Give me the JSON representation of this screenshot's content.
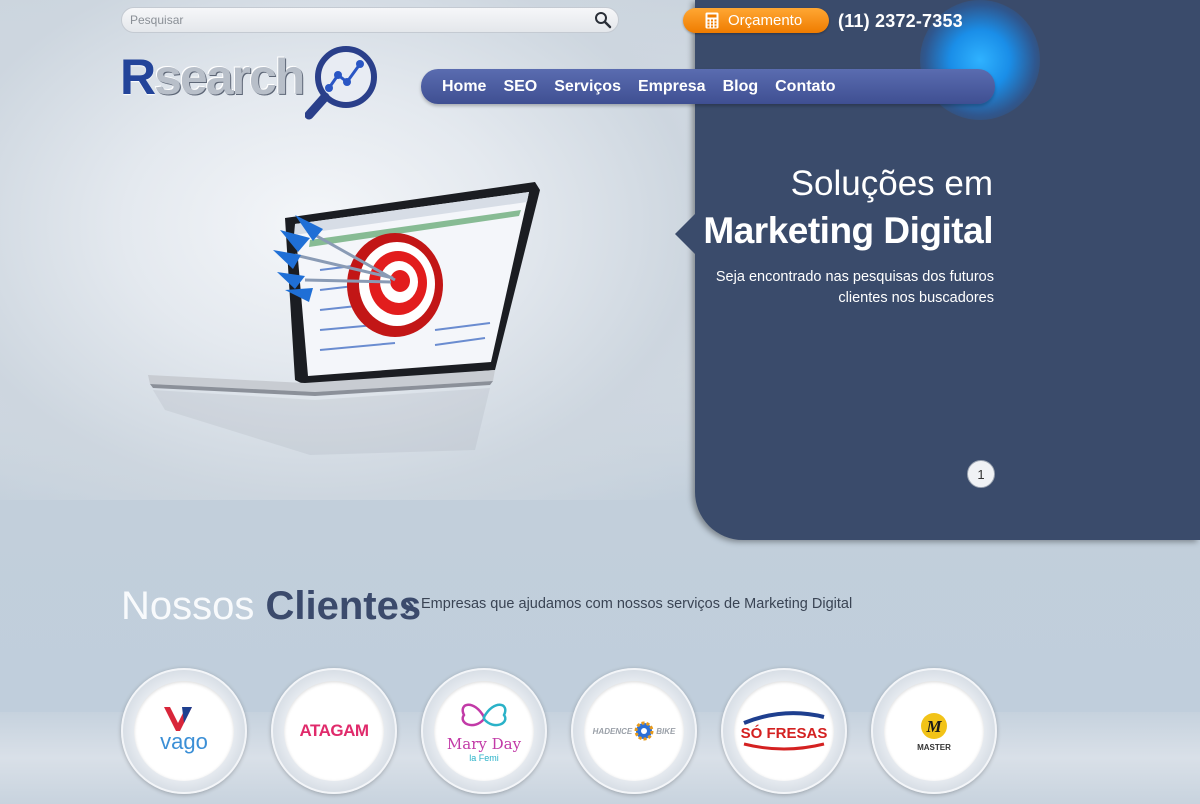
{
  "search": {
    "placeholder": "Pesquisar"
  },
  "header": {
    "quote_label": "Orçamento",
    "phone": "(11) 2372-7353",
    "logo": {
      "r": "R",
      "rest": "search"
    }
  },
  "nav": {
    "items": [
      {
        "label": "Home"
      },
      {
        "label": "SEO"
      },
      {
        "label": "Serviços"
      },
      {
        "label": "Empresa"
      },
      {
        "label": "Blog"
      },
      {
        "label": "Contato"
      }
    ]
  },
  "hero": {
    "line1": "Soluções em",
    "line2": "Marketing Digital",
    "subtitle": "Seja encontrado nas pesquisas dos futuros clientes nos buscadores",
    "slide_number": "1"
  },
  "clients": {
    "title_light": "Nossos ",
    "title_bold": "Clientes",
    "subtitle": "Empresas que ajudamos com nossos serviços de Marketing Digital",
    "logos": [
      {
        "text": "vago"
      },
      {
        "text": "ATAGAM"
      },
      {
        "text": "Mary Day",
        "sub": "la Femi"
      },
      {
        "text": "HADENCE",
        "sub": "BIKE"
      },
      {
        "text": "SÓ FRESAS"
      },
      {
        "text": "MASTER"
      }
    ]
  },
  "colors": {
    "panel": "#3a4b6b",
    "nav": "#4a5ba1",
    "accent_orange": "#f28a0e",
    "logo_blue": "#23449a"
  }
}
